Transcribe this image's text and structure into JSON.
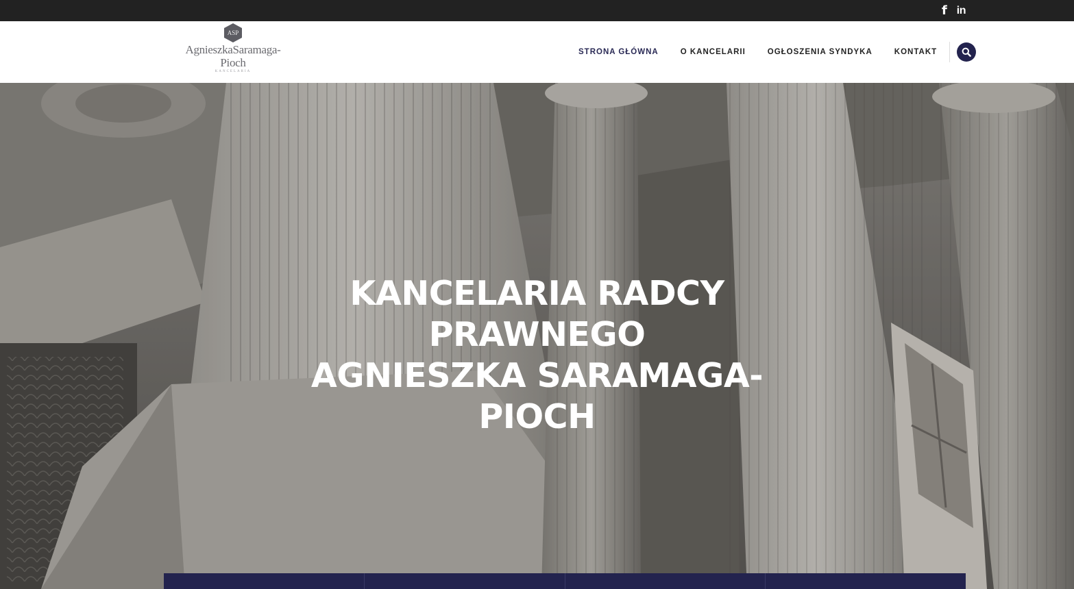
{
  "topbar": {
    "social": [
      {
        "icon": "facebook-icon",
        "glyph": "f"
      },
      {
        "icon": "linkedin-icon",
        "glyph": "in"
      }
    ]
  },
  "logo": {
    "badge": "ASP",
    "name_line1": "AgnieszkaSaramaga-",
    "name_line2": "Pioch",
    "sub": "KANCELARIA"
  },
  "nav": {
    "items": [
      {
        "label": "STRONA GŁÓWNA",
        "active": true
      },
      {
        "label": "O KANCELARII",
        "active": false
      },
      {
        "label": "OGŁOSZENIA SYNDYKA",
        "active": false
      },
      {
        "label": "KONTAKT",
        "active": false
      }
    ],
    "search_icon": "search-icon"
  },
  "hero": {
    "title_lines": [
      "KANCELARIA RADCY",
      "PRAWNEGO",
      "AGNIESZKA SARAMAGA-",
      "PIOCH"
    ]
  },
  "colors": {
    "topbar": "#222222",
    "accent": "#23234e",
    "hero_text": "#ffffff"
  }
}
